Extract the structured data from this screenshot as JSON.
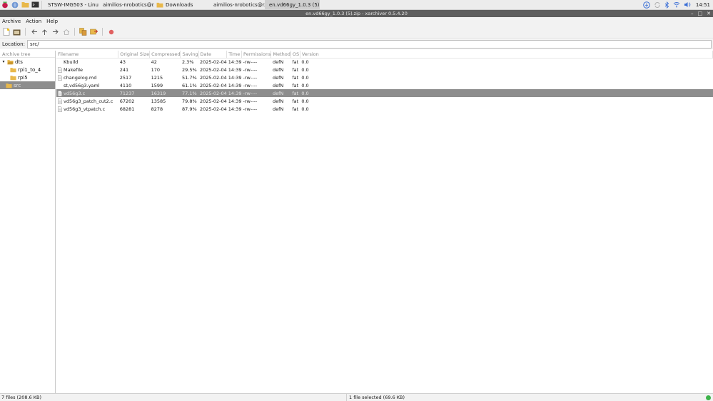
{
  "taskbar": {
    "launchers": [
      "raspberry-icon",
      "globe-icon",
      "folder-icon",
      "terminal-icon"
    ],
    "tasks": [
      {
        "label": "STSW-IMG503 - Linu...",
        "icon": "chromium-icon",
        "active": false
      },
      {
        "label": "aimilios-nrobotics@r...",
        "icon": "terminal-icon",
        "active": false
      },
      {
        "label": "Downloads",
        "icon": "folder-icon",
        "active": false
      },
      {
        "label": "aimilios-nrobotics@r...",
        "icon": "terminal-icon",
        "active": false
      },
      {
        "label": "en.vd66gy_1.0.3 (5)...",
        "icon": "archive-icon",
        "active": true
      }
    ],
    "clock": "14:51"
  },
  "window": {
    "title": "en.vd66gy_1.0.3 (5).zip - xarchiver 0.5.4.20"
  },
  "menu": [
    "Archive",
    "Action",
    "Help"
  ],
  "location": {
    "label": "Location:",
    "value": "src/"
  },
  "tree": {
    "header": "Archive tree",
    "items": [
      {
        "label": "dts",
        "level": 0,
        "expanded": true,
        "selected": false
      },
      {
        "label": "rpi1_to_4",
        "level": 1,
        "expanded": false,
        "selected": false
      },
      {
        "label": "rpi5",
        "level": 1,
        "expanded": false,
        "selected": false
      },
      {
        "label": "src",
        "level": 0,
        "expanded": false,
        "selected": true
      }
    ]
  },
  "columns": [
    "Filename",
    "Original Size",
    "Compressed",
    "Saving",
    "Date",
    "Time",
    "Permissions",
    "Method",
    "OS",
    "Version"
  ],
  "files": [
    {
      "name": "Kbuild",
      "icon": false,
      "size": "43",
      "compressed": "42",
      "saving": "2.3%",
      "date": "2025-02-04",
      "time": "14:39",
      "perm": "-rw----",
      "method": "defN",
      "os": "fat",
      "version": "0.0",
      "selected": false
    },
    {
      "name": "Makefile",
      "icon": true,
      "size": "241",
      "compressed": "170",
      "saving": "29.5%",
      "date": "2025-02-04",
      "time": "14:39",
      "perm": "-rw----",
      "method": "defN",
      "os": "fat",
      "version": "0.0",
      "selected": false
    },
    {
      "name": "changelog.md",
      "icon": true,
      "size": "2517",
      "compressed": "1215",
      "saving": "51.7%",
      "date": "2025-02-04",
      "time": "14:39",
      "perm": "-rw----",
      "method": "defN",
      "os": "fat",
      "version": "0.0",
      "selected": false
    },
    {
      "name": "st,vd56g3.yaml",
      "icon": false,
      "size": "4110",
      "compressed": "1599",
      "saving": "61.1%",
      "date": "2025-02-04",
      "time": "14:39",
      "perm": "-rw----",
      "method": "defN",
      "os": "fat",
      "version": "0.0",
      "selected": false
    },
    {
      "name": "vd56g3.c",
      "icon": true,
      "size": "71237",
      "compressed": "16319",
      "saving": "77.1%",
      "date": "2025-02-04",
      "time": "14:39",
      "perm": "-rw----",
      "method": "defN",
      "os": "fat",
      "version": "0.0",
      "selected": true
    },
    {
      "name": "vd56g3_patch_cut2.c",
      "icon": true,
      "size": "67202",
      "compressed": "13585",
      "saving": "79.8%",
      "date": "2025-02-04",
      "time": "14:39",
      "perm": "-rw----",
      "method": "defN",
      "os": "fat",
      "version": "0.0",
      "selected": false
    },
    {
      "name": "vd56g3_vtpatch.c",
      "icon": true,
      "size": "68281",
      "compressed": "8278",
      "saving": "87.9%",
      "date": "2025-02-04",
      "time": "14:39",
      "perm": "-rw----",
      "method": "defN",
      "os": "fat",
      "version": "0.0",
      "selected": false
    }
  ],
  "status": {
    "left": "7 files  (208.6 KB)",
    "right": "1 file selected (69.6 KB)"
  },
  "colors": {
    "selection": "#8d8d8d",
    "titlebar": "#5e5e5e",
    "folder": "#e8b84b",
    "status_dot": "#3db34a"
  }
}
